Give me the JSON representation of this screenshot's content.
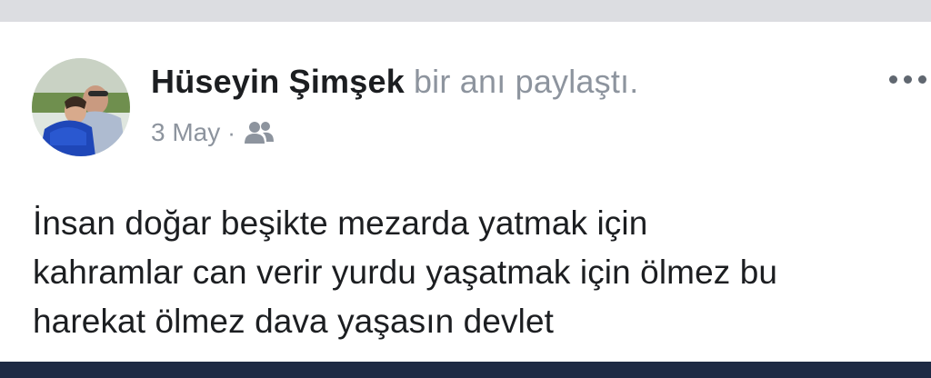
{
  "post": {
    "author_name": "Hüseyin Şimşek",
    "action_text": "bir anı paylaştı.",
    "date": "3 May",
    "separator": "·",
    "audience_icon": "friends-icon",
    "more_icon": "more-options-icon",
    "body_lines": [
      "İnsan doğar beşikte mezarda yatmak için",
      "kahramlar can verir yurdu yaşatmak için ölmez bu",
      "harekat ölmez dava yaşasın devlet"
    ]
  },
  "colors": {
    "top_strip": "#dcdde1",
    "bottom_strip": "#1e2a44",
    "name_text": "#1c1e21",
    "secondary_text": "#8d949e"
  }
}
